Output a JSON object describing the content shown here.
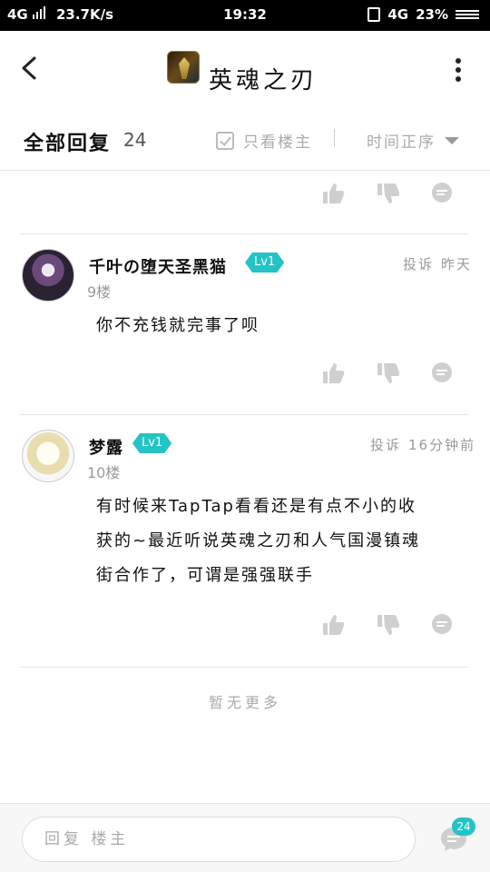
{
  "status_bar": {
    "network": "4G",
    "speed": "23.7K/s",
    "time": "19:32",
    "network_right": "4G",
    "battery": "23%"
  },
  "header": {
    "title": "英魂之刃",
    "back_icon": "chevron-left-icon",
    "menu_icon": "more-vertical-icon"
  },
  "filters": {
    "all_replies_label": "全部回复",
    "reply_count": "24",
    "only_owner_label": "只看楼主",
    "sort_label": "时间正序"
  },
  "posts": [
    {
      "author": "千叶の堕天圣黑猫",
      "level": "Lv1",
      "floor": "9楼",
      "report": "投诉",
      "time": "昨天",
      "content": "你不充钱就完事了呗"
    },
    {
      "author": "梦露",
      "level": "Lv1",
      "floor": "10楼",
      "report": "投诉",
      "time": "16分钟前",
      "content_lines": [
        "有时候来TapTap看看还是有点不小的收",
        "获的~最近听说英魂之刃和人气国漫镇魂",
        "街合作了，可谓是强强联手"
      ]
    }
  ],
  "footer_text": "暂无更多",
  "bottom_bar": {
    "input_placeholder": "回复 楼主",
    "comment_count": "24"
  },
  "colors": {
    "accent": "#23c3c6",
    "icon_gray": "#cfcfcf"
  }
}
